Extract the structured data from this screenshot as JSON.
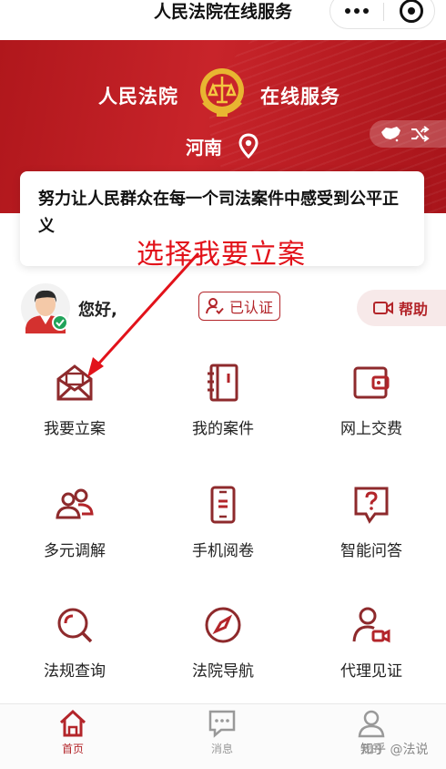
{
  "navbar": {
    "title": "人民法院在线服务"
  },
  "banner": {
    "left_text": "人民法院",
    "right_text": "在线服务",
    "region": "河南"
  },
  "slogan": "努力让人民群众在每一个司法案件中感受到公平正义",
  "annotation": "选择我要立案",
  "user": {
    "greeting": "您好,",
    "verified_label": "已认证",
    "help_label": "帮助"
  },
  "services": [
    {
      "label": "我要立案",
      "icon": "envelope-icon"
    },
    {
      "label": "我的案件",
      "icon": "notebook-icon"
    },
    {
      "label": "网上交费",
      "icon": "wallet-icon"
    },
    {
      "label": "多元调解",
      "icon": "people-icon"
    },
    {
      "label": "手机阅卷",
      "icon": "phone-doc-icon"
    },
    {
      "label": "智能问答",
      "icon": "question-chat-icon"
    },
    {
      "label": "法规查询",
      "icon": "search-icon"
    },
    {
      "label": "法院导航",
      "icon": "compass-icon"
    },
    {
      "label": "代理见证",
      "icon": "video-person-icon"
    }
  ],
  "tabbar": {
    "items": [
      {
        "label": "首页",
        "icon": "home-icon",
        "active": true
      },
      {
        "label": "消息",
        "icon": "message-icon",
        "active": false
      },
      {
        "label": "我的",
        "icon": "user-icon",
        "active": false
      }
    ]
  },
  "watermark": "知乎 @法说",
  "colors": {
    "brand_red": "#b3252a",
    "annotation_red": "#e2121a"
  }
}
